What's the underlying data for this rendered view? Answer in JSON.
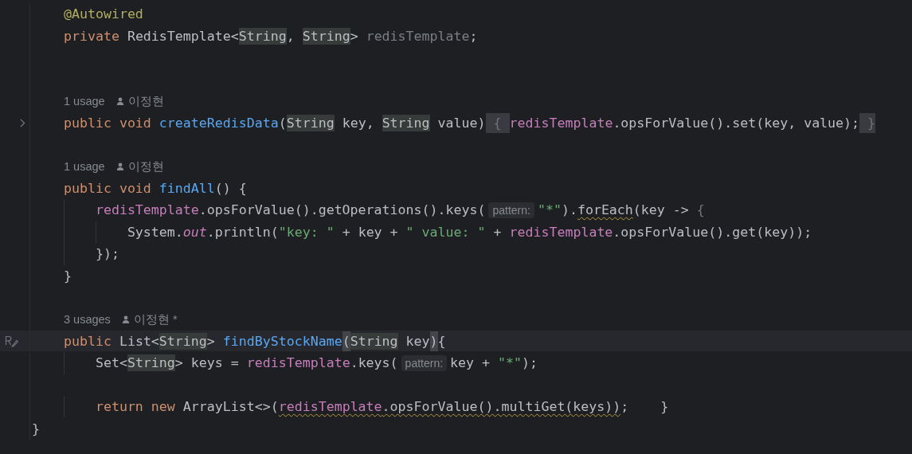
{
  "editor": {
    "lines": [
      {
        "kind": "code",
        "current": false,
        "tokens": [
          {
            "t": "    @Autowired",
            "kind": "annotation"
          }
        ]
      },
      {
        "kind": "code",
        "current": false,
        "tokens": [
          {
            "t": "    private ",
            "kind": "keyword"
          },
          {
            "t": "RedisTemplate<",
            "kind": "plain"
          },
          {
            "t": "String",
            "kind": "usage_hl"
          },
          {
            "t": ", ",
            "kind": "plain"
          },
          {
            "t": "String",
            "kind": "usage_hl"
          },
          {
            "t": "> ",
            "kind": "plain"
          },
          {
            "t": "redisTemplate",
            "kind": "unused"
          },
          {
            "t": ";",
            "kind": "plain"
          }
        ]
      },
      {
        "kind": "blank",
        "current": false
      },
      {
        "kind": "blank",
        "current": false
      },
      {
        "kind": "hint",
        "current": false,
        "usages": "1 usage",
        "author": "이정현"
      },
      {
        "kind": "code",
        "current": false,
        "gutter": {
          "kind": "fold"
        },
        "tokens": [
          {
            "t": "    public void ",
            "kind": "keyword"
          },
          {
            "t": "createRedisData",
            "kind": "method"
          },
          {
            "t": "(",
            "kind": "plain"
          },
          {
            "t": "String",
            "kind": "usage_hl"
          },
          {
            "t": " key, ",
            "kind": "plain"
          },
          {
            "t": "String",
            "kind": "usage_hl"
          },
          {
            "t": " value)",
            "kind": "plain"
          },
          {
            "t": " { ",
            "kind": "fold"
          },
          {
            "t": "redisTemplate",
            "kind": "field"
          },
          {
            "t": ".opsForValue().set(key, value);",
            "kind": "plain"
          },
          {
            "t": " }",
            "kind": "fold"
          }
        ]
      },
      {
        "kind": "blank",
        "current": false
      },
      {
        "kind": "hint",
        "current": false,
        "usages": "1 usage",
        "author": "이정현"
      },
      {
        "kind": "code",
        "current": false,
        "tokens": [
          {
            "t": "    public void ",
            "kind": "keyword"
          },
          {
            "t": "findAll",
            "kind": "method"
          },
          {
            "t": "() {",
            "kind": "plain"
          }
        ]
      },
      {
        "kind": "code",
        "current": false,
        "tokens": [
          {
            "t": "        redisTemplate",
            "kind": "field"
          },
          {
            "t": ".opsForValue().getOperations().keys(",
            "kind": "plain"
          },
          {
            "t": "pattern:",
            "kind": "param_hint"
          },
          {
            "t": "\"*\"",
            "kind": "string"
          },
          {
            "t": ").",
            "kind": "plain"
          },
          {
            "t": "forEach",
            "kind": "plain_warn"
          },
          {
            "t": "(key -> ",
            "kind": "plain"
          },
          {
            "t": "{",
            "kind": "dim"
          }
        ]
      },
      {
        "kind": "code",
        "current": false,
        "tokens": [
          {
            "t": "            System.",
            "kind": "plain"
          },
          {
            "t": "out",
            "kind": "static"
          },
          {
            "t": ".println(",
            "kind": "plain"
          },
          {
            "t": "\"key: \"",
            "kind": "string"
          },
          {
            "t": " + key + ",
            "kind": "plain"
          },
          {
            "t": "\" value: \"",
            "kind": "string"
          },
          {
            "t": " + ",
            "kind": "plain"
          },
          {
            "t": "redisTemplate",
            "kind": "field"
          },
          {
            "t": ".opsForValue().get(key));",
            "kind": "plain"
          }
        ]
      },
      {
        "kind": "code",
        "current": false,
        "tokens": [
          {
            "t": "        });",
            "kind": "plain"
          }
        ]
      },
      {
        "kind": "code",
        "current": false,
        "tokens": [
          {
            "t": "    }",
            "kind": "plain"
          }
        ]
      },
      {
        "kind": "blank",
        "current": false
      },
      {
        "kind": "hint",
        "current": false,
        "usages": "3 usages",
        "author": "이정현 *"
      },
      {
        "kind": "code",
        "current": true,
        "gutter": {
          "kind": "author"
        },
        "tokens": [
          {
            "t": "    public ",
            "kind": "keyword"
          },
          {
            "t": "List<",
            "kind": "plain"
          },
          {
            "t": "String",
            "kind": "usage_hl"
          },
          {
            "t": "> ",
            "kind": "plain"
          },
          {
            "t": "findByStockName",
            "kind": "method"
          },
          {
            "t": "(",
            "kind": "brace_hl"
          },
          {
            "t": "String",
            "kind": "usage_hl"
          },
          {
            "t": " key",
            "kind": "plain"
          },
          {
            "t": ")",
            "kind": "brace_hl"
          },
          {
            "t": "{",
            "kind": "plain"
          }
        ]
      },
      {
        "kind": "code",
        "current": false,
        "tokens": [
          {
            "t": "        Set<",
            "kind": "plain"
          },
          {
            "t": "String",
            "kind": "usage_hl"
          },
          {
            "t": "> keys = ",
            "kind": "plain"
          },
          {
            "t": "redisTemplate",
            "kind": "field"
          },
          {
            "t": ".keys(",
            "kind": "plain"
          },
          {
            "t": "pattern:",
            "kind": "param_hint"
          },
          {
            "t": "key + ",
            "kind": "plain"
          },
          {
            "t": "\"*\"",
            "kind": "string"
          },
          {
            "t": ");",
            "kind": "plain"
          }
        ]
      },
      {
        "kind": "blank",
        "current": false
      },
      {
        "kind": "code",
        "current": false,
        "tokens": [
          {
            "t": "        return new ",
            "kind": "keyword"
          },
          {
            "t": "ArrayList<>(",
            "kind": "plain"
          },
          {
            "t": "redisTemplate",
            "kind": "field_warn"
          },
          {
            "t": ".opsForValue().multiGet(keys))",
            "kind": "plain_warn"
          },
          {
            "t": ";    }",
            "kind": "plain"
          }
        ]
      },
      {
        "kind": "code",
        "current": false,
        "tokens": [
          {
            "t": "}",
            "kind": "plain"
          }
        ]
      }
    ]
  }
}
